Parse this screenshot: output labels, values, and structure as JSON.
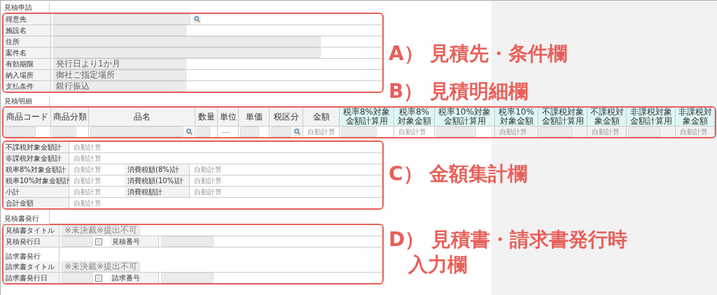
{
  "estimate_request": {
    "title": "見積申請",
    "rows": [
      {
        "label": "得意先",
        "kind": "search"
      },
      {
        "label": "施設名",
        "kind": "short"
      },
      {
        "label": "住所",
        "kind": "long"
      },
      {
        "label": "案件名",
        "kind": "long"
      },
      {
        "label": "有効期限",
        "kind": "short",
        "value": "発行日より1か月"
      },
      {
        "label": "納入場所",
        "kind": "short",
        "value": "御社ご指定場所"
      },
      {
        "label": "支払条件",
        "kind": "short",
        "value": "銀行振込"
      }
    ]
  },
  "estimate_details": {
    "title": "見積明細",
    "columns": [
      {
        "label": "商品コード",
        "kind": "input",
        "highlight": false
      },
      {
        "label": "商品分類",
        "kind": "input",
        "highlight": false
      },
      {
        "label": "品名",
        "kind": "search",
        "highlight": false
      },
      {
        "label": "数量",
        "kind": "input",
        "highlight": false
      },
      {
        "label": "単位",
        "kind": "text",
        "value": "---",
        "highlight": false
      },
      {
        "label": "単価",
        "kind": "input",
        "highlight": false
      },
      {
        "label": "税区分",
        "kind": "search",
        "highlight": false
      },
      {
        "label": "金額",
        "kind": "text",
        "value": "自動計算",
        "highlight": false
      },
      {
        "label": "税率8%対象金額計算用",
        "kind": "input",
        "highlight": true
      },
      {
        "label": "税率8%対象金額",
        "kind": "text",
        "value": "自動計算",
        "highlight": true
      },
      {
        "label": "税率10%対象金額計算用",
        "kind": "input",
        "highlight": true
      },
      {
        "label": "税率10%対象金額",
        "kind": "text",
        "value": "自動計算",
        "highlight": true
      },
      {
        "label": "不課税対象金額計算用",
        "kind": "input",
        "highlight": true
      },
      {
        "label": "不課税対象金額",
        "kind": "text",
        "value": "自動計算",
        "highlight": true
      },
      {
        "label": "非課税対象金額計算用",
        "kind": "input",
        "highlight": true
      },
      {
        "label": "非課税対象金額",
        "kind": "text",
        "value": "自動計算",
        "highlight": true
      }
    ]
  },
  "totals": {
    "rows": [
      {
        "cells": [
          {
            "label": "不課税対象金額計",
            "value": "自動計算"
          }
        ]
      },
      {
        "cells": [
          {
            "label": "非課税対象金額計",
            "value": "自動計算"
          }
        ]
      },
      {
        "cells": [
          {
            "label": "税率8%対象金額計",
            "value": "自動計算"
          },
          {
            "label": "消費税額(8%)計",
            "value": "自動計算"
          }
        ]
      },
      {
        "cells": [
          {
            "label": "税率10%対象金額計",
            "value": "自動計算"
          },
          {
            "label": "消費税額(10%)計",
            "value": "自動計算"
          }
        ]
      },
      {
        "cells": [
          {
            "label": "小計",
            "value": "自動計算"
          },
          {
            "label": "消費税額計",
            "value": "自動計算"
          }
        ]
      },
      {
        "cells": [
          {
            "label": "合計金額",
            "value": "自動計算"
          }
        ]
      }
    ]
  },
  "issuance": [
    {
      "title": "見積書発行",
      "title_label": "見積書タイトル",
      "title_value": "※未決裁※提出不可",
      "date_label": "見積発行日",
      "number_label": "見積番号"
    },
    {
      "title": "請求書発行",
      "title_label": "請求書タイトル",
      "title_value": "※未決裁※提出不可",
      "date_label": "請求書発行日",
      "number_label": "請求番号"
    }
  ],
  "annotations": [
    {
      "lines": [
        "A） 見積先・条件欄"
      ]
    },
    {
      "lines": [
        "B） 見積明細欄"
      ]
    },
    {
      "lines": [
        "C） 金額集計欄"
      ]
    },
    {
      "lines": [
        "D） 見積書・請求書発行時",
        "入力欄"
      ]
    }
  ]
}
